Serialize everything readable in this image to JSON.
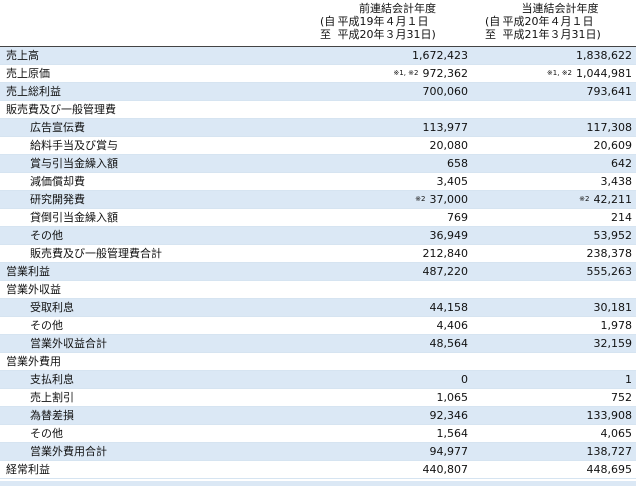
{
  "header": {
    "prev": {
      "title": "前連結会計年度",
      "from_paren": "(自",
      "from": "平成19年４月１日",
      "to_label": "至",
      "to": "平成20年３月31日)"
    },
    "curr": {
      "title": "当連結会計年度",
      "from_paren": "(自",
      "from": "平成20年４月１日",
      "to_label": "至",
      "to": "平成21年３月31日)"
    }
  },
  "rows": [
    {
      "label": "売上高",
      "prev": "1,672,423",
      "curr": "1,838,622"
    },
    {
      "label": "売上原価",
      "prev_note": "※1, ※2",
      "prev": "972,362",
      "curr_note": "※1, ※2",
      "curr": "1,044,981"
    },
    {
      "label": "売上総利益",
      "prev": "700,060",
      "curr": "793,641"
    },
    {
      "label": "販売費及び一般管理費",
      "prev": "",
      "curr": ""
    },
    {
      "label": "広告宣伝費",
      "prev": "113,977",
      "curr": "117,308"
    },
    {
      "label": "給料手当及び賞与",
      "prev": "20,080",
      "curr": "20,609"
    },
    {
      "label": "賞与引当金繰入額",
      "prev": "658",
      "curr": "642"
    },
    {
      "label": "減価償却費",
      "prev": "3,405",
      "curr": "3,438"
    },
    {
      "label": "研究開発費",
      "prev_note": "※2",
      "prev": "37,000",
      "curr_note": "※2",
      "curr": "42,211"
    },
    {
      "label": "貸倒引当金繰入額",
      "prev": "769",
      "curr": "214"
    },
    {
      "label": "その他",
      "prev": "36,949",
      "curr": "53,952"
    },
    {
      "label": "販売費及び一般管理費合計",
      "prev": "212,840",
      "curr": "238,378"
    },
    {
      "label": "営業利益",
      "prev": "487,220",
      "curr": "555,263"
    },
    {
      "label": "営業外収益",
      "prev": "",
      "curr": ""
    },
    {
      "label": "受取利息",
      "prev": "44,158",
      "curr": "30,181"
    },
    {
      "label": "その他",
      "prev": "4,406",
      "curr": "1,978"
    },
    {
      "label": "営業外収益合計",
      "prev": "48,564",
      "curr": "32,159"
    },
    {
      "label": "営業外費用",
      "prev": "",
      "curr": ""
    },
    {
      "label": "支払利息",
      "prev": "0",
      "curr": "1"
    },
    {
      "label": "売上割引",
      "prev": "1,065",
      "curr": "752"
    },
    {
      "label": "為替差損",
      "prev": "92,346",
      "curr": "133,908"
    },
    {
      "label": "その他",
      "prev": "1,564",
      "curr": "4,065"
    },
    {
      "label": "営業外費用合計",
      "prev": "94,977",
      "curr": "138,727"
    },
    {
      "label": "経常利益",
      "prev": "440,807",
      "curr": "448,695"
    }
  ]
}
